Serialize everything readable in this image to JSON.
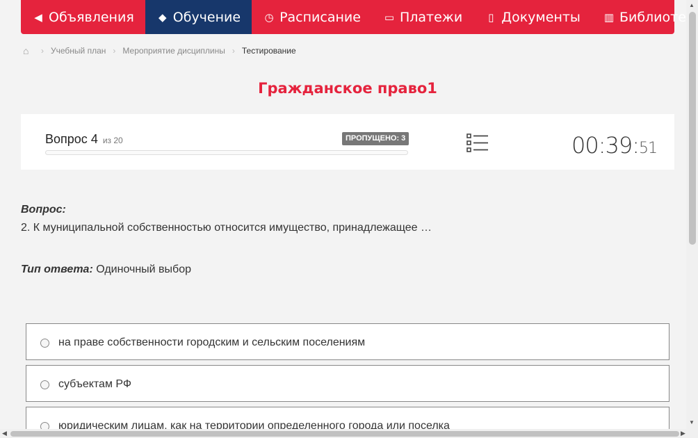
{
  "nav": {
    "items": [
      {
        "label": "Объявления",
        "icon": "megaphone-icon"
      },
      {
        "label": "Обучение",
        "icon": "graduation-cap-icon"
      },
      {
        "label": "Расписание",
        "icon": "clock-icon"
      },
      {
        "label": "Платежи",
        "icon": "money-icon"
      },
      {
        "label": "Документы",
        "icon": "document-icon"
      },
      {
        "label": "Библиотека",
        "icon": "book-icon"
      }
    ],
    "active_index": 1,
    "accent": "#e5233d",
    "active_color": "#17376b"
  },
  "breadcrumb": {
    "items": [
      "Учебный план",
      "Мероприятие дисциплины"
    ],
    "current": "Тестирование"
  },
  "page_title": "Гражданское право1",
  "progress_panel": {
    "question_word": "Вопрос",
    "question_number": "4",
    "of_text": "из 20",
    "skipped_badge": "ПРОПУЩЕНО: 3",
    "progress_fraction": 0.0,
    "timer_main": "00:39:",
    "timer_seconds": "51"
  },
  "question": {
    "heading": "Вопрос:",
    "text": "2. К муниципальной собственностью относится имущество, принадлежащее …",
    "answer_type_label": "Тип ответа:",
    "answer_type_value": "Одиночный выбор"
  },
  "options": [
    "на праве собственности городским и сельским поселениям",
    "субъектам РФ",
    "юридическим лицам, как на территории определенного города или поселка"
  ]
}
